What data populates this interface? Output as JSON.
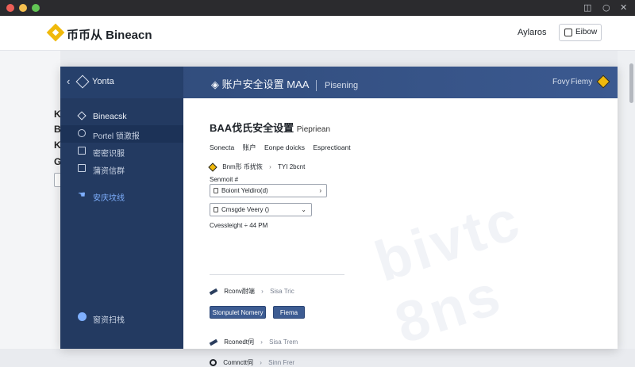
{
  "window": {
    "controls": [
      "◫",
      "○",
      "✕"
    ]
  },
  "header": {
    "brand": "币币从 Bineacn",
    "link": "Aylaros",
    "button": "Eibow"
  },
  "background": {
    "glyphs": [
      "K",
      "B",
      "K",
      "G"
    ]
  },
  "modal": {
    "nav_title": "Yonta",
    "breadcrumb": "账户安全设置",
    "breadcrumb_extra": "MAA",
    "breadcrumb_sub": "Pisening",
    "right_links": [
      "Fovy",
      "Fiemy"
    ]
  },
  "sidebar": {
    "items": [
      {
        "label": "Bineacsk",
        "icon": "cube-icon"
      },
      {
        "label": "Portel  锁激报",
        "icon": "search-icon"
      },
      {
        "label": "密密识服",
        "icon": "list-icon"
      },
      {
        "label": "蒲资信群",
        "icon": "server-icon"
      },
      {
        "label": "安庆坟线",
        "icon": "pointer-icon"
      },
      {
        "label": "窗资扫栈",
        "icon": "info-icon"
      }
    ]
  },
  "content": {
    "title": "BAA伐氏安全设置",
    "title_suffix": "Piepriean",
    "tabs": [
      "Sonecta",
      "账户",
      "Eonpe doicks",
      "Esprectioant"
    ],
    "crumb_row": {
      "left": "Bnm形 币扰恢",
      "right": "TYI 2bcnt"
    },
    "field_label": "Senmoit #",
    "select1": "Boiont Yeldiro(d)",
    "select2": "Cmsgde Veery ()",
    "timestamp": "Cvessleight ÷ 44 PM",
    "rows": [
      {
        "label": "Rconv耐端",
        "value": "Sisa Tric"
      },
      {
        "label": "Rconedt伺",
        "value": "Sisa Trem"
      },
      {
        "label": "Comnctt伺",
        "value": "Sinn Frer"
      }
    ],
    "buttons": [
      "Stonpulet Nomery",
      "Fiema"
    ],
    "watermark": "bivtc 8ns"
  }
}
